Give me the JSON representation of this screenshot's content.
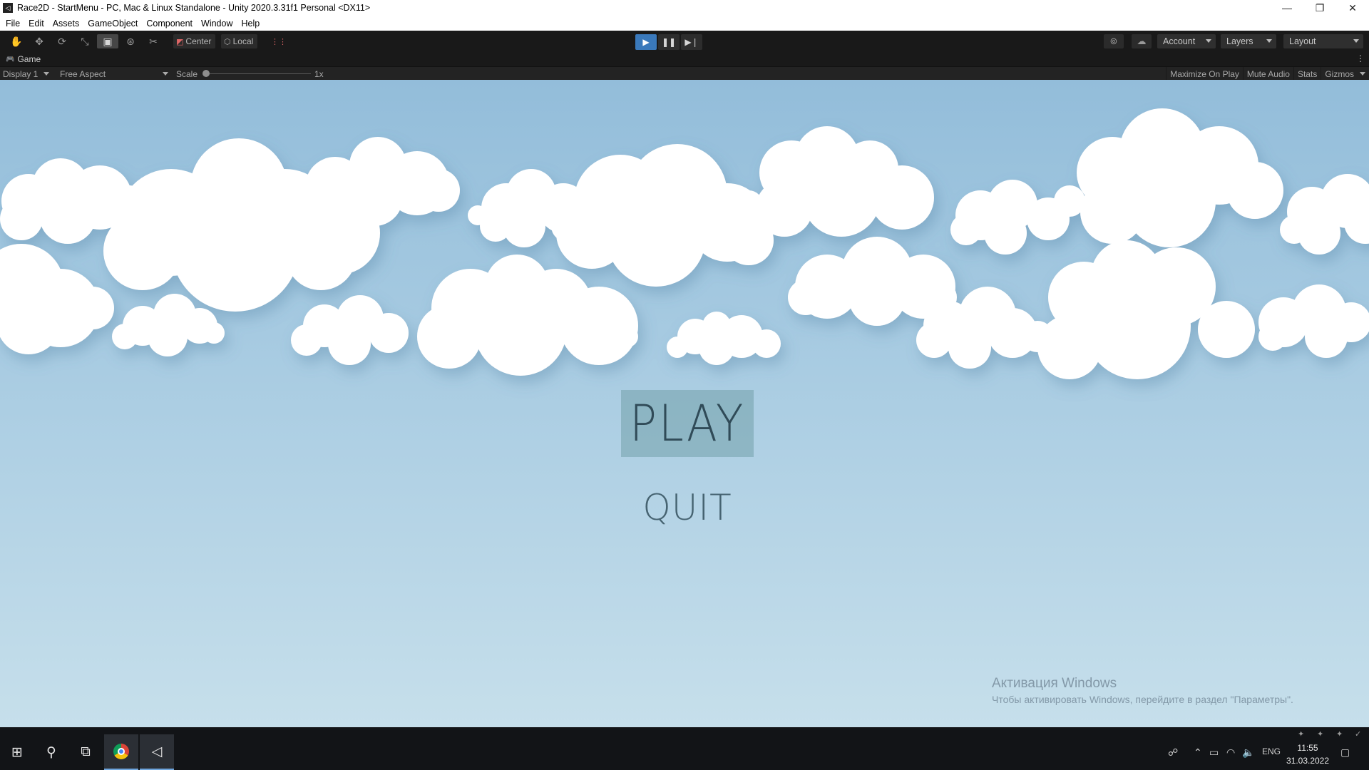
{
  "window": {
    "title": "Race2D - StartMenu - PC, Mac & Linux Standalone - Unity 2020.3.31f1 Personal <DX11>",
    "app_icon": "unity-icon",
    "controls": {
      "minimize": "—",
      "restore": "❐",
      "close": "✕"
    }
  },
  "menu": [
    "File",
    "Edit",
    "Assets",
    "GameObject",
    "Component",
    "Window",
    "Help"
  ],
  "toolbar": {
    "tools": [
      {
        "name": "hand-tool-icon",
        "glyph": "✋"
      },
      {
        "name": "move-tool-icon",
        "glyph": "✥"
      },
      {
        "name": "rotate-tool-icon",
        "glyph": "⟳"
      },
      {
        "name": "scale-tool-icon",
        "glyph": "⤡"
      },
      {
        "name": "rect-tool-icon",
        "glyph": "▣"
      },
      {
        "name": "transform-tool-icon",
        "glyph": "⊛"
      },
      {
        "name": "custom-tool-icon",
        "glyph": "✂"
      }
    ],
    "pivot_label": "Center",
    "space_label": "Local",
    "grid_glyph": "⋮⋮",
    "play_glyph": "▶",
    "pause_glyph": "❚❚",
    "step_glyph": "▶❘",
    "collab_glyph": "⊚",
    "cloud_glyph": "☁",
    "account_label": "Account",
    "layers_label": "Layers",
    "layout_label": "Layout"
  },
  "game_panel": {
    "tab_label": "Game",
    "tab_glyph": "🎮",
    "kebab": "⋮",
    "display": "Display 1",
    "aspect": "Free Aspect",
    "scale_label": "Scale",
    "scale_value": "1x",
    "maximize_on_play": "Maximize On Play",
    "mute_audio": "Mute Audio",
    "stats": "Stats",
    "gizmos": "Gizmos"
  },
  "game": {
    "play_label": "PLAY",
    "quit_label": "QUIT",
    "colors": {
      "sky_top": "#93bdda",
      "sky_bottom": "#c6dfeb",
      "cloud": "#ffffff",
      "button_text": "#27404d"
    }
  },
  "watermark": {
    "title": "Активация Windows",
    "text": "Чтобы активировать Windows, перейдите в раздел \"Параметры\"."
  },
  "taskbar": {
    "start_glyph": "⊞",
    "search_glyph": "⚲",
    "taskview_glyph": "⧉",
    "unity_glyph": "◁",
    "language": "ENG",
    "time": "11:55",
    "date": "31.03.2022",
    "tray_glyphs": {
      "people": "☍",
      "chevron": "⌃",
      "battery": "▭",
      "wifi": "◠",
      "volume": "🔈",
      "notifications": "▢"
    }
  }
}
